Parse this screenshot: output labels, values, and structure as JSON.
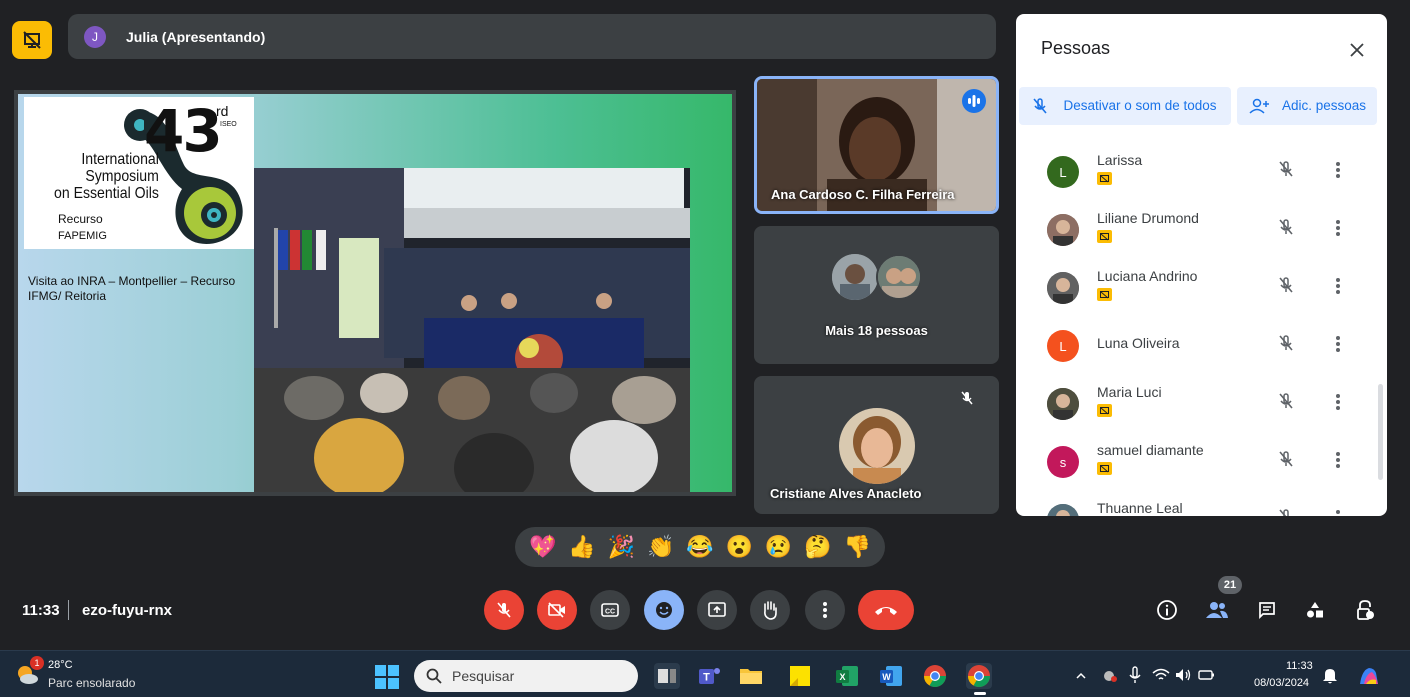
{
  "presenter": {
    "initial": "J",
    "name": "Julia (Apresentando)"
  },
  "slide": {
    "logo_number": "43",
    "logo_rd": "rd",
    "logo_iseo": "ISEO",
    "logo_title": "International\nSymposium\non Essential Oils",
    "logo_recurso": "Recurso",
    "logo_fapemig": "FAPEMIG",
    "caption": "Visita ao INRA – Montpellier – Recurso IFMG/ Reitoria"
  },
  "tiles": {
    "speaking": {
      "name": "Ana Cardoso C. Filha Ferreira"
    },
    "more": {
      "label": "Mais 18 pessoas"
    },
    "muted": {
      "name": "Cristiane Alves Anacleto"
    }
  },
  "panel": {
    "title": "Pessoas",
    "mute_all": "Desativar o som de todos",
    "add_people": "Adic. pessoas",
    "people": [
      {
        "name": "Larissa",
        "initial": "L",
        "color": "#33691e",
        "photo": false
      },
      {
        "name": "Liliane Drumond",
        "initial": "",
        "color": "#8d6e63",
        "photo": true
      },
      {
        "name": "Luciana Andrino",
        "initial": "",
        "color": "#616161",
        "photo": true
      },
      {
        "name": "Luna Oliveira",
        "initial": "L",
        "color": "#f4511e",
        "photo": false
      },
      {
        "name": "Maria Luci",
        "initial": "",
        "color": "#4e4e3e",
        "photo": true
      },
      {
        "name": "samuel diamante",
        "initial": "s",
        "color": "#c2185b",
        "photo": false
      },
      {
        "name": "Thuanne Leal",
        "initial": "",
        "color": "#546e7a",
        "photo": true
      }
    ]
  },
  "reactions": [
    "💖",
    "👍",
    "🎉",
    "👏",
    "😂",
    "😮",
    "😢",
    "🤔",
    "👎"
  ],
  "meeting": {
    "time": "11:33",
    "code": "ezo-fuyu-rnx",
    "participants": "21"
  },
  "taskbar": {
    "weather_badge": "1",
    "temperature": "28°C",
    "weather": "Parc ensolarado",
    "search_placeholder": "Pesquisar",
    "clock_time": "11:33",
    "clock_date": "08/03/2024"
  },
  "colors": {
    "accent": "#8ab4f8",
    "danger": "#ea4335",
    "panel_link": "#1a73e8",
    "present": "#fbbc04"
  }
}
